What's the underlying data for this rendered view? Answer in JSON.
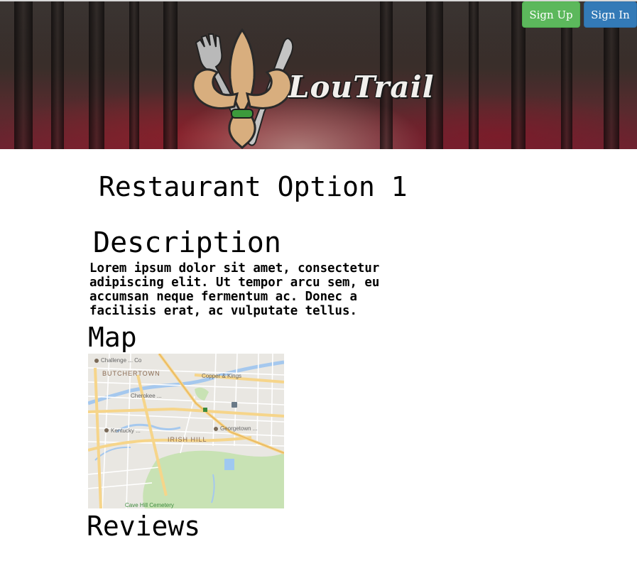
{
  "header": {
    "brand": "LouTrail",
    "signup_label": "Sign Up",
    "signin_label": "Sign In",
    "colors": {
      "signup": "#5cb85c",
      "signin": "#337ab7"
    }
  },
  "restaurant": {
    "title": "Restaurant Option 1",
    "description_heading": "Description",
    "description_text": "Lorem ipsum dolor sit amet, consectetur\nadipiscing elit. Ut tempor arcu sem, eu\naccumsan neque fermentum ac. Donec a\nfacilisis erat, ac vulputate tellus.",
    "map_heading": "Map",
    "reviews_heading": "Reviews"
  },
  "map": {
    "labels": {
      "top_left": "Challenge ... Co",
      "neighborhood_1": "BUTCHERTOWN",
      "neighborhood_2": "IRISH HILL",
      "poi": "Copper & Kings",
      "poi_2": "Georgetown ...",
      "poi_3": "Kentucky ...",
      "poi_4": "Cherokee ...",
      "footer": "Cave Hill Cemetery"
    }
  }
}
